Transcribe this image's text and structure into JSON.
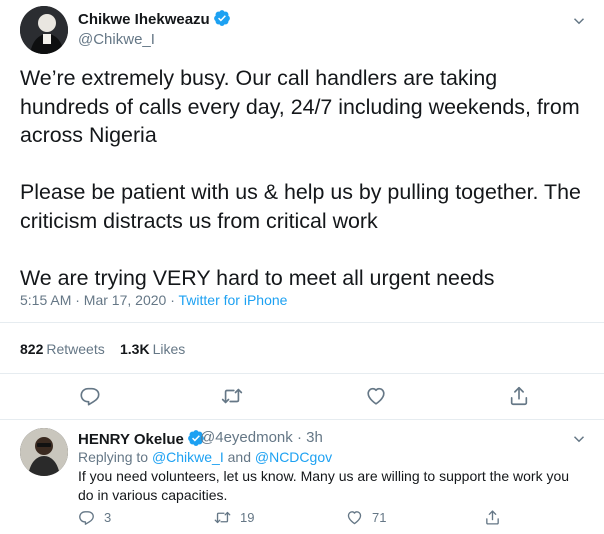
{
  "main_tweet": {
    "author_name": "Chikwe Ihekweazu",
    "author_handle": "@Chikwe_I",
    "paragraphs": [
      "We’re extremely busy. Our call handlers are taking hundreds of calls every day, 24/7 including weekends, from across Nigeria",
      "Please be patient with us & help us by pulling together. The criticism distracts us from critical work",
      "We are trying VERY hard to meet all urgent needs"
    ],
    "timestamp": "5:15 AM · Mar 17, 2020 · ",
    "source": "Twitter for iPhone",
    "retweet_count": "822",
    "retweet_label": "Retweets",
    "like_count": "1.3K",
    "like_label": "Likes",
    "icons": [
      "reply-icon",
      "retweet-icon",
      "like-icon",
      "share-icon"
    ]
  },
  "reply_tweet": {
    "author_name": "HENRY Okelue",
    "author_handle": "@4eyedmonk · 3h",
    "replying_prefix": "Replying to ",
    "mention_1": "@Chikwe_I",
    "replying_and": " and ",
    "mention_2": "@NCDCgov",
    "text": "If you need volunteers, let us know. Many us are willing to support the work you do in various capacities.",
    "reply_count": "3",
    "retweet_count": "19",
    "like_count": "71"
  },
  "colors": {
    "accent": "#1da1f2",
    "muted": "#657786",
    "text": "#14171a",
    "border": "#e6ecf0"
  }
}
